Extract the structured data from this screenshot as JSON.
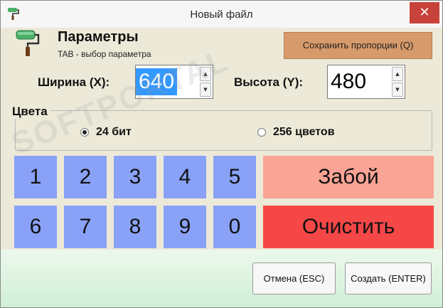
{
  "window": {
    "title": "Новый файл",
    "close_glyph": "✕"
  },
  "header": {
    "title": "Параметры",
    "subtitle": "TAB - выбор параметра",
    "icon": "paint-roller-icon"
  },
  "keep_proportions_label": "Сохранить пропорции (Q)",
  "width": {
    "label": "Ширина (X):",
    "value": "640"
  },
  "height": {
    "label": "Высота (Y):",
    "value": "480"
  },
  "colors": {
    "label": "Цвета",
    "options": [
      {
        "label": "24 бит",
        "selected": true
      },
      {
        "label": "256 цветов",
        "selected": false
      }
    ]
  },
  "keypad": {
    "keys": [
      "1",
      "2",
      "3",
      "4",
      "5",
      "6",
      "7",
      "8",
      "9",
      "0"
    ],
    "backspace": "Забой",
    "clear": "Очистить"
  },
  "footer": {
    "cancel": "Отмена (ESC)",
    "create": "Создать (ENTER)"
  },
  "watermark": "SOFTPORTAL",
  "theme": {
    "key": "#89a2f7",
    "backspace": "#faa495",
    "clear": "#f64747",
    "keep": "#d79a6a",
    "selection": "#3399ff"
  }
}
